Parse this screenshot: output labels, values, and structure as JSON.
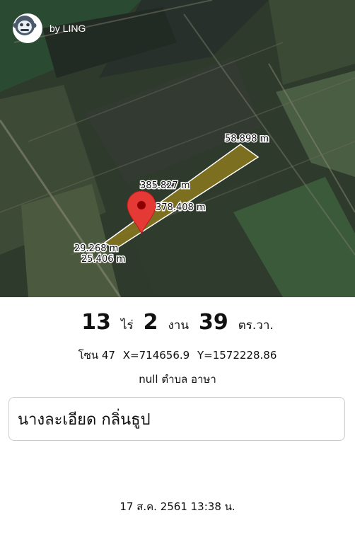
{
  "brand": {
    "text": "by LING",
    "icon": "monkey-icon"
  },
  "map": {
    "parcel_fill": "#8a7a1f",
    "pin_color": "#e53935",
    "measurements": [
      "58.898 m",
      "385.827 m",
      "378.408 m",
      "29.268 m",
      "25.406 m"
    ],
    "icons": [
      "location-pin-icon"
    ]
  },
  "area": {
    "rai": "13",
    "rai_unit": "ไร่",
    "ngan": "2",
    "ngan_unit": "งาน",
    "wa": "39",
    "wa_unit": "ตร.วา."
  },
  "coords": {
    "zone": "โซน 47",
    "x": "X=714656.9",
    "y": "Y=1572228.86"
  },
  "location": "null ตำบล อาษา",
  "owner": "นางละเอียด กลิ่นธูป",
  "timestamp": "17 ส.ค. 2561 13:38 น."
}
